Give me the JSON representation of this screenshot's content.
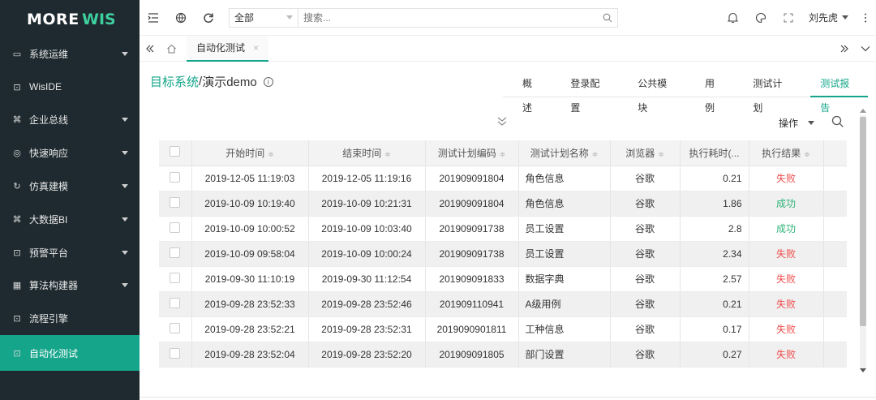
{
  "logo": {
    "text": "MOREWIS"
  },
  "sidebar": {
    "items": [
      {
        "icon": "monitor-icon",
        "glyph": "▭",
        "label": "系统运维",
        "expandable": true
      },
      {
        "icon": "ide-icon",
        "glyph": "⊡",
        "label": "WisIDE",
        "expandable": false
      },
      {
        "icon": "command-icon",
        "glyph": "⌘",
        "label": "企业总线",
        "expandable": true
      },
      {
        "icon": "chat-icon",
        "glyph": "◎",
        "label": "快速响应",
        "expandable": true
      },
      {
        "icon": "sync-icon",
        "glyph": "↻",
        "label": "仿真建模",
        "expandable": true
      },
      {
        "icon": "command-icon",
        "glyph": "⌘",
        "label": "大数据BI",
        "expandable": true
      },
      {
        "icon": "alert-icon",
        "glyph": "⊡",
        "label": "预警平台",
        "expandable": true
      },
      {
        "icon": "grid-icon",
        "glyph": "▦",
        "label": "算法构建器",
        "expandable": true
      },
      {
        "icon": "flow-icon",
        "glyph": "⊡",
        "label": "流程引擎",
        "expandable": false
      },
      {
        "icon": "test-icon",
        "glyph": "⊡",
        "label": "自动化测试",
        "expandable": false,
        "active": true
      }
    ]
  },
  "topbar": {
    "scope_select": "全部",
    "search_placeholder": "搜索...",
    "user_name": "刘先虎"
  },
  "tabbar": {
    "active_tab": "自动化测试"
  },
  "page": {
    "breadcrumb_link": "目标系统",
    "breadcrumb_sep": "/",
    "breadcrumb_current": "演示demo",
    "subtabs": [
      "概述",
      "登录配置",
      "公共模块",
      "用例",
      "测试计划",
      "测试报告"
    ],
    "active_subtab": "测试报告",
    "operations_label": "操作"
  },
  "table": {
    "columns": [
      "开始时间",
      "结束时间",
      "测试计划编码",
      "测试计划名称",
      "浏览器",
      "执行耗时(...",
      "执行结果"
    ],
    "rows": [
      {
        "start": "2019-12-05 11:19:03",
        "end": "2019-12-05 11:19:16",
        "code": "201909091804",
        "name": "角色信息",
        "browser": "谷歌",
        "duration": "0.21",
        "result": "失败"
      },
      {
        "start": "2019-10-09 10:19:40",
        "end": "2019-10-09 10:21:31",
        "code": "201909091804",
        "name": "角色信息",
        "browser": "谷歌",
        "duration": "1.86",
        "result": "成功"
      },
      {
        "start": "2019-10-09 10:00:52",
        "end": "2019-10-09 10:03:40",
        "code": "201909091738",
        "name": "员工设置",
        "browser": "谷歌",
        "duration": "2.8",
        "result": "成功"
      },
      {
        "start": "2019-10-09 09:58:04",
        "end": "2019-10-09 10:00:24",
        "code": "201909091738",
        "name": "员工设置",
        "browser": "谷歌",
        "duration": "2.34",
        "result": "失败"
      },
      {
        "start": "2019-09-30 11:10:19",
        "end": "2019-09-30 11:12:54",
        "code": "201909091833",
        "name": "数据字典",
        "browser": "谷歌",
        "duration": "2.57",
        "result": "失败"
      },
      {
        "start": "2019-09-28 23:52:33",
        "end": "2019-09-28 23:52:46",
        "code": "201909110941",
        "name": "A级用例",
        "browser": "谷歌",
        "duration": "0.21",
        "result": "失败"
      },
      {
        "start": "2019-09-28 23:52:21",
        "end": "2019-09-28 23:52:31",
        "code": "2019090901811",
        "name": "工种信息",
        "browser": "谷歌",
        "duration": "0.17",
        "result": "失败"
      },
      {
        "start": "2019-09-28 23:52:04",
        "end": "2019-09-28 23:52:20",
        "code": "201909091805",
        "name": "部门设置",
        "browser": "谷歌",
        "duration": "0.27",
        "result": "失败"
      }
    ]
  },
  "colors": {
    "accent": "#14a58a",
    "sidebar_bg": "#1e2a2f",
    "fail": "#ef4e4e",
    "success": "#2fb37a"
  }
}
